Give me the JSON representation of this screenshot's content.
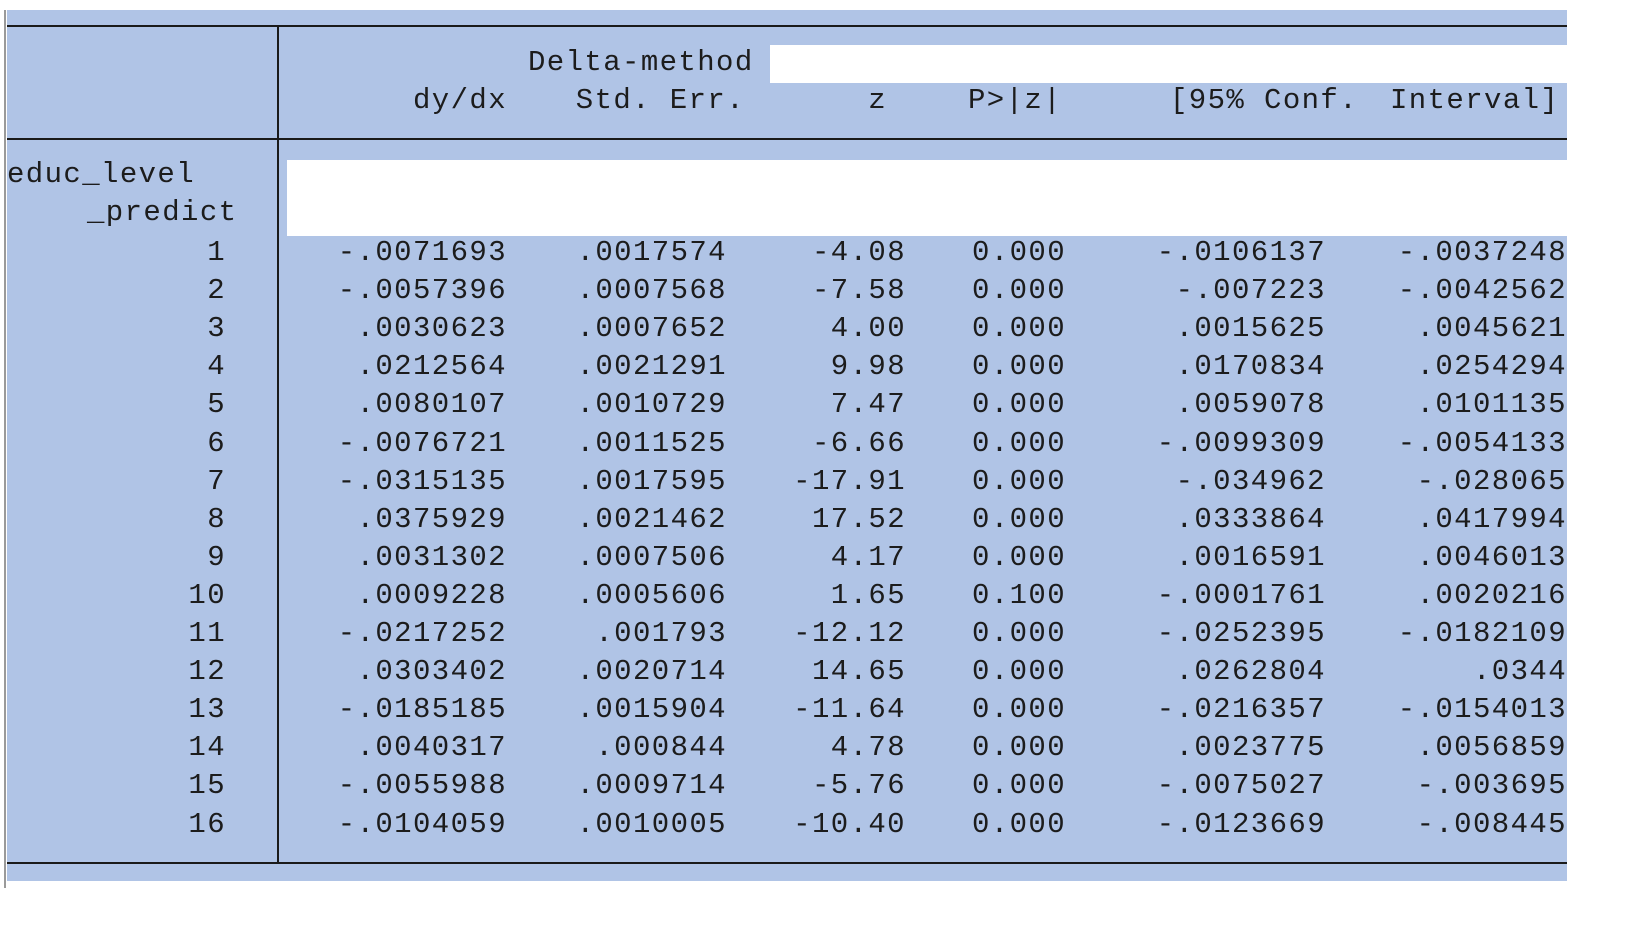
{
  "header": {
    "delta_method": "Delta-method",
    "columns": [
      "dy/dx",
      "Std. Err.",
      "z",
      "P>|z|",
      "[95% Conf.",
      "Interval]"
    ]
  },
  "row_label": {
    "variable": "educ_level",
    "sub": "_predict"
  },
  "rows": [
    [
      "1",
      "-.0071693",
      ".0017574",
      "-4.08",
      "0.000",
      "-.0106137",
      "-.0037248"
    ],
    [
      "2",
      "-.0057396",
      ".0007568",
      "-7.58",
      "0.000",
      "-.007223",
      "-.0042562"
    ],
    [
      "3",
      ".0030623",
      ".0007652",
      "4.00",
      "0.000",
      ".0015625",
      ".0045621"
    ],
    [
      "4",
      ".0212564",
      ".0021291",
      "9.98",
      "0.000",
      ".0170834",
      ".0254294"
    ],
    [
      "5",
      ".0080107",
      ".0010729",
      "7.47",
      "0.000",
      ".0059078",
      ".0101135"
    ],
    [
      "6",
      "-.0076721",
      ".0011525",
      "-6.66",
      "0.000",
      "-.0099309",
      "-.0054133"
    ],
    [
      "7",
      "-.0315135",
      ".0017595",
      "-17.91",
      "0.000",
      "-.034962",
      "-.028065"
    ],
    [
      "8",
      ".0375929",
      ".0021462",
      "17.52",
      "0.000",
      ".0333864",
      ".0417994"
    ],
    [
      "9",
      ".0031302",
      ".0007506",
      "4.17",
      "0.000",
      ".0016591",
      ".0046013"
    ],
    [
      "10",
      ".0009228",
      ".0005606",
      "1.65",
      "0.100",
      "-.0001761",
      ".0020216"
    ],
    [
      "11",
      "-.0217252",
      ".001793",
      "-12.12",
      "0.000",
      "-.0252395",
      "-.0182109"
    ],
    [
      "12",
      ".0303402",
      ".0020714",
      "14.65",
      "0.000",
      ".0262804",
      ".0344"
    ],
    [
      "13",
      "-.0185185",
      ".0015904",
      "-11.64",
      "0.000",
      "-.0216357",
      "-.0154013"
    ],
    [
      "14",
      ".0040317",
      ".000844",
      "4.78",
      "0.000",
      ".0023775",
      ".0056859"
    ],
    [
      "15",
      "-.0055988",
      ".0009714",
      "-5.76",
      "0.000",
      "-.0075027",
      "-.003695"
    ],
    [
      "16",
      "-.0104059",
      ".0010005",
      "-10.40",
      "0.000",
      "-.0123669",
      "-.008445"
    ]
  ],
  "colors": {
    "background": "#b0c4e6",
    "text": "#1c1c1c",
    "rule": "#1a1a1a"
  }
}
